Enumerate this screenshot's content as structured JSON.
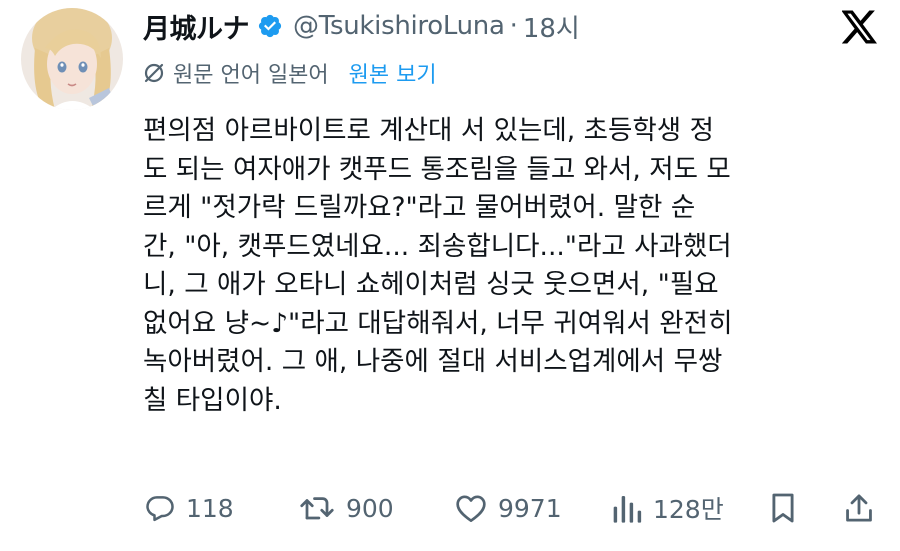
{
  "author": {
    "display_name": "月城ルナ",
    "handle": "@TsukishiroLuna",
    "separator": "·",
    "time": "18시",
    "verified": true
  },
  "translation": {
    "label": "원문 언어 일본어",
    "show_original": "원본 보기",
    "icon": "translate-icon"
  },
  "text_lines": [
    "편의점 아르바이트로 계산대 서 있는데, 초등학생 정",
    "도 되는 여자애가 캣푸드 통조림을 들고 와서, 저도 모",
    "르게 \"젓가락 드릴까요?\"라고 물어버렸어. 말한 순",
    "간, \"아, 캣푸드였네요... 죄송합니다...\"라고 사과했더",
    "니, 그 애가 오타니 쇼헤이처럼 싱긋 웃으면서, \"필요",
    "없어요 냥~♪\"라고 대답해줘서, 너무 귀여워서 완전히",
    "녹아버렸어. 그 애, 나중에 절대 서비스업계에서 무쌍",
    "칠 타입이야."
  ],
  "actions": {
    "replies": "118",
    "reposts": "900",
    "likes": "9971",
    "views": "128만"
  },
  "colors": {
    "text": "#0f1419",
    "secondary": "#536471",
    "accent": "#1d9bf0"
  }
}
